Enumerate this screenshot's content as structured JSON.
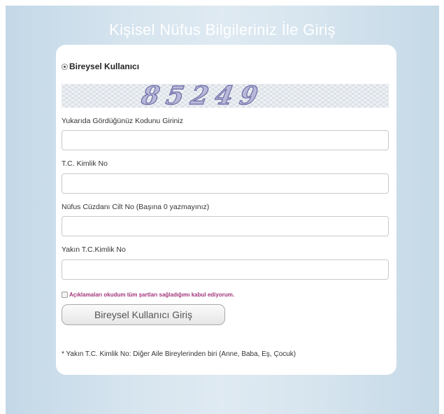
{
  "page": {
    "title": "Kişisel Nüfus Bilgileriniz İle Giriş"
  },
  "login_type": {
    "label": "Bireysel Kullanıcı",
    "selected": true
  },
  "captcha": {
    "text": "85249"
  },
  "fields": {
    "captcha_label": "Yukarıda Gördüğünüz Kodunu Giriniz",
    "captcha_value": "",
    "tc_label": "T.C. Kimlik No",
    "tc_value": "",
    "cilt_label": "Nüfus Cüzdanı Cilt No (Başına 0 yazmayınız)",
    "cilt_value": "",
    "yakin_label": "Yakın T.C.Kimlik No",
    "yakin_value": ""
  },
  "agreement": {
    "label": "Açıklamaları okudum tüm şartları sağladığımı kabul ediyorum.",
    "checked": false
  },
  "submit": {
    "label": "Bireysel Kullanıcı Giriş"
  },
  "note": "* Yakın T.C. Kimlik No: Diğer Aile Bireylerinden biri (Anne, Baba, Eş, Çocuk)",
  "colors": {
    "accent": "#a2347a",
    "background": "#d5e4ee"
  }
}
